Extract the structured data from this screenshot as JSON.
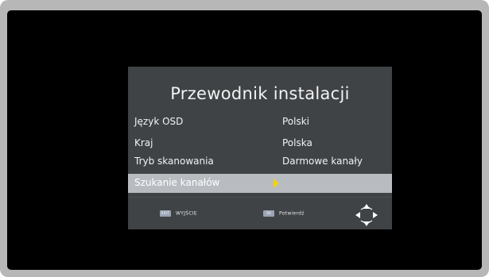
{
  "osd": {
    "title": "Przewodnik instalacji",
    "rows": [
      {
        "label": "Język OSD",
        "value": "Polski"
      },
      {
        "label": "Kraj",
        "value": "Polska"
      },
      {
        "label": "Tryb skanowania",
        "value": "Darmowe kanały"
      },
      {
        "label": "Szukanie kanałów",
        "value": ""
      }
    ],
    "selected_row": 3
  },
  "footer": {
    "exit": {
      "key": "EXIT",
      "label": "WYJŚCIE"
    },
    "ok": {
      "key": "OK",
      "label": "Potwierdź"
    },
    "nav_icon": "dpad-arrows-icon"
  },
  "colors": {
    "frame": "#b7b7b7",
    "screen": "#000000",
    "panel": "#3f4346",
    "highlight": "#b8bcc1",
    "cursor": "#f3d20a",
    "key": "#9aa4b4"
  }
}
